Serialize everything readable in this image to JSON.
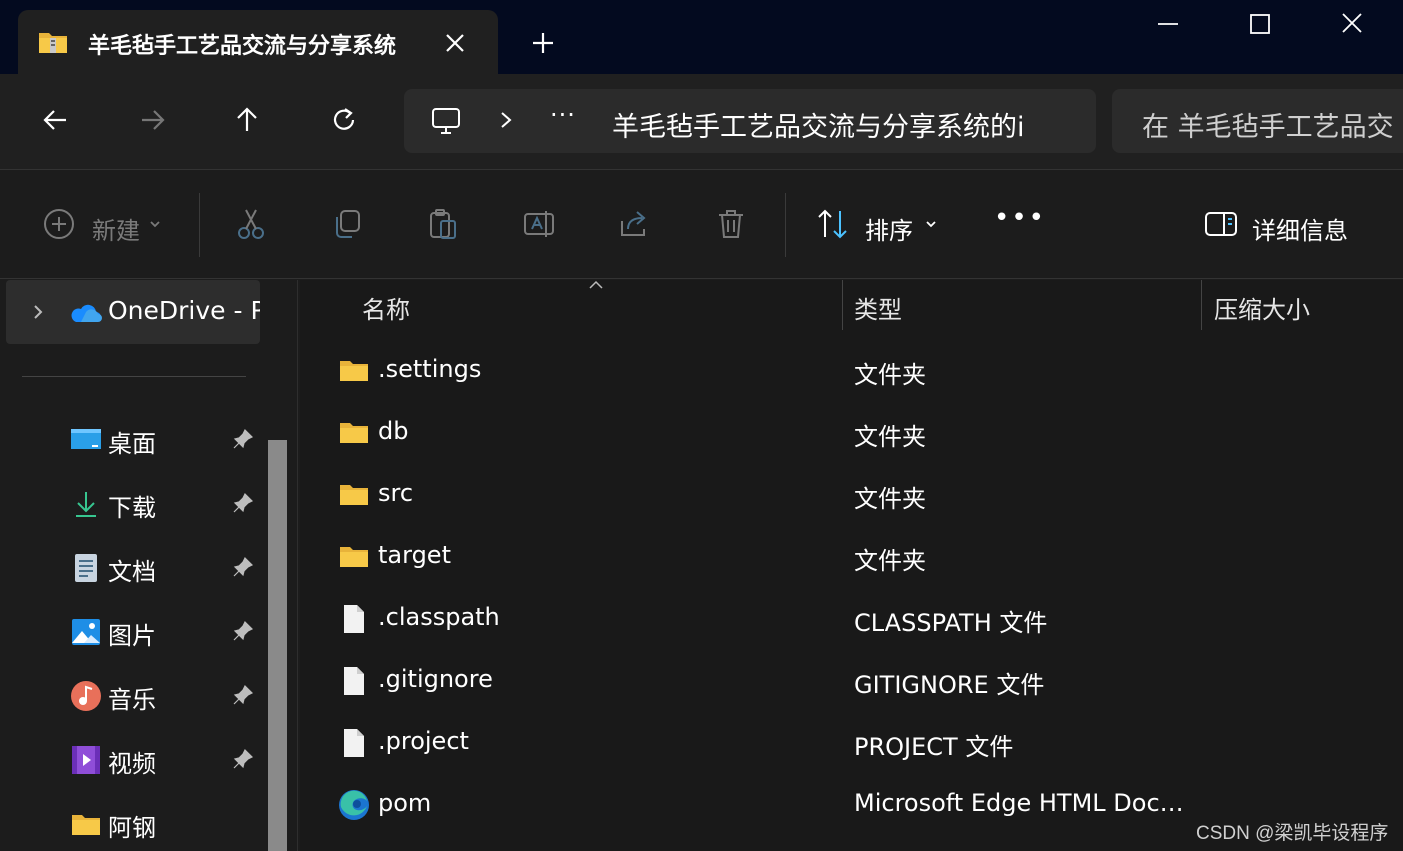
{
  "tab": {
    "title": "羊毛毡手工艺品交流与分享系统",
    "close_icon": "close-icon",
    "new_tab_icon": "plus-icon"
  },
  "window_controls": {
    "minimize": "minimize-icon",
    "maximize": "maximize-icon",
    "close": "close-icon"
  },
  "nav": {
    "back": "arrow-left-icon",
    "forward": "arrow-right-icon",
    "up": "arrow-up-icon",
    "refresh": "refresh-icon",
    "address": {
      "device_icon": "monitor-icon",
      "overflow": "···",
      "path": "羊毛毡手工艺品交流与分享系统的i"
    },
    "search_placeholder": "在 羊毛毡手工艺品交"
  },
  "toolbar": {
    "new_label": "新建",
    "sort_label": "排序",
    "details_label": "详细信息",
    "more": "•••",
    "buttons": [
      "cut-icon",
      "copy-icon",
      "paste-icon",
      "rename-icon",
      "share-icon",
      "delete-icon"
    ]
  },
  "sidebar": {
    "onedrive_label": "OneDrive - Pe",
    "items": [
      {
        "label": "桌面",
        "icon": "desktop-icon",
        "pinned": true
      },
      {
        "label": "下载",
        "icon": "download-icon",
        "pinned": true
      },
      {
        "label": "文档",
        "icon": "document-icon",
        "pinned": true
      },
      {
        "label": "图片",
        "icon": "picture-icon",
        "pinned": true
      },
      {
        "label": "音乐",
        "icon": "music-icon",
        "pinned": true
      },
      {
        "label": "视频",
        "icon": "video-icon",
        "pinned": true
      },
      {
        "label": "阿钢",
        "icon": "folder-icon",
        "pinned": false
      }
    ]
  },
  "columns": {
    "name": "名称",
    "type": "类型",
    "size": "压缩大小"
  },
  "files": [
    {
      "name": ".settings",
      "type": "文件夹",
      "icon": "folder-icon"
    },
    {
      "name": "db",
      "type": "文件夹",
      "icon": "folder-icon"
    },
    {
      "name": "src",
      "type": "文件夹",
      "icon": "folder-icon"
    },
    {
      "name": "target",
      "type": "文件夹",
      "icon": "folder-icon"
    },
    {
      "name": ".classpath",
      "type": "CLASSPATH 文件",
      "icon": "file-icon"
    },
    {
      "name": ".gitignore",
      "type": "GITIGNORE 文件",
      "icon": "file-icon"
    },
    {
      "name": ".project",
      "type": "PROJECT 文件",
      "icon": "file-icon"
    },
    {
      "name": "pom",
      "type": "Microsoft Edge HTML Docu...",
      "icon": "edge-icon"
    }
  ],
  "watermark": "CSDN @梁凯毕设程序",
  "colors": {
    "titlebar": "#030a1f",
    "folder": "#f7c948",
    "accent": "#4cc2ff"
  }
}
